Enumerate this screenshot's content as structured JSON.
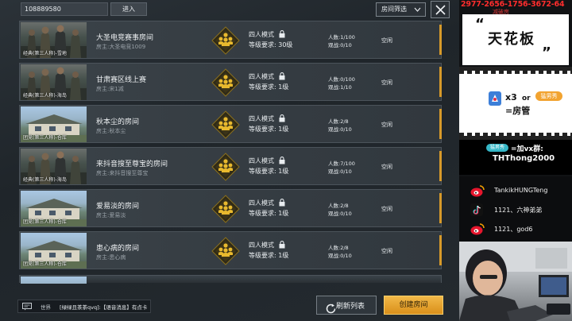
{
  "topbar": {
    "room_search_value": "108889580",
    "enter_label": "进入",
    "filter_label": "房间筛选"
  },
  "rooms": [
    {
      "name": "大圣电竞赛事房间",
      "owner": "房主:大圣电竞1009",
      "mode_caption": "经典(第三人称)-雪地",
      "thumb": "squad",
      "team_mode": "四人模式",
      "level_req": "等级要求: 30级",
      "players": "人数:1/100",
      "spectators": "观战:0/10",
      "status": "空闲"
    },
    {
      "name": "甘肃赛区线上赛",
      "owner": "房主:宋1减",
      "mode_caption": "经典(第三人称)-海岛",
      "thumb": "squad",
      "team_mode": "四人模式",
      "level_req": "等级要求: 1级",
      "players": "人数:0/100",
      "spectators": "观战:1/10",
      "status": "空闲"
    },
    {
      "name": "秋本尘的房间",
      "owner": "房主:秋本尘",
      "mode_caption": "团竞(第三人称)-仓库",
      "thumb": "house",
      "team_mode": "四人模式",
      "level_req": "等级要求: 1级",
      "players": "人数:2/8",
      "spectators": "观战:0/10",
      "status": "空闲"
    },
    {
      "name": "来抖音搜至尊宝的房间",
      "owner": "房主:来抖音搜至尊宝",
      "mode_caption": "经典(第三人称)-海岛",
      "thumb": "squad",
      "team_mode": "四人模式",
      "level_req": "等级要求: 1级",
      "players": "人数:7/100",
      "spectators": "观战:0/10",
      "status": "空闲"
    },
    {
      "name": "爱易淡的房间",
      "owner": "房主:爱易淡",
      "mode_caption": "团竞(第三人称)-仓库",
      "thumb": "house",
      "team_mode": "四人模式",
      "level_req": "等级要求: 1级",
      "players": "人数:2/8",
      "spectators": "观战:0/10",
      "status": "空闲"
    },
    {
      "name": "患心病的房间",
      "owner": "房主:患心病",
      "mode_caption": "团竞(第三人称)-仓库",
      "thumb": "house",
      "team_mode": "四人模式",
      "level_req": "等级要求: 1级",
      "players": "人数:2/8",
      "spectators": "观战:0/10",
      "status": "空闲"
    }
  ],
  "bottombar": {
    "chat_channel": "世界",
    "chat_message": "[绿绿且茶茶qvq]:【语音消息】有点卡",
    "refresh_label": "刷新列表",
    "create_label": "创建房间"
  },
  "overlay": {
    "phone_number": "2977-2656-1756-3672-64",
    "subtitle": "减破房",
    "ceiling_quote_open": "“",
    "ceiling_text": "天花板",
    "ceiling_quote_close": "”",
    "ticket_x3": "x3",
    "ticket_or": "or",
    "badge_label": "猛男秀",
    "ticket_result": "=房管",
    "join_badge": "猛男秀",
    "join_label": "=加vx群:",
    "join_id": "THThong2000",
    "weibo_1": "TankikHUNGTeng",
    "douyin": "1121、六神弟弟",
    "weibo_2": "1121、god6"
  },
  "colors": {
    "accent_orange": "#d79a2a",
    "create_button": "#f2b948",
    "team_icon_gold": "#e8b92e",
    "overlay_red": "#ff2d2d"
  },
  "icons": [
    "chevron-down-icon",
    "close-icon",
    "squad-icon",
    "lock-icon",
    "chat-icon",
    "refresh-icon",
    "gift-icon",
    "weibo-icon",
    "douyin-icon"
  ]
}
